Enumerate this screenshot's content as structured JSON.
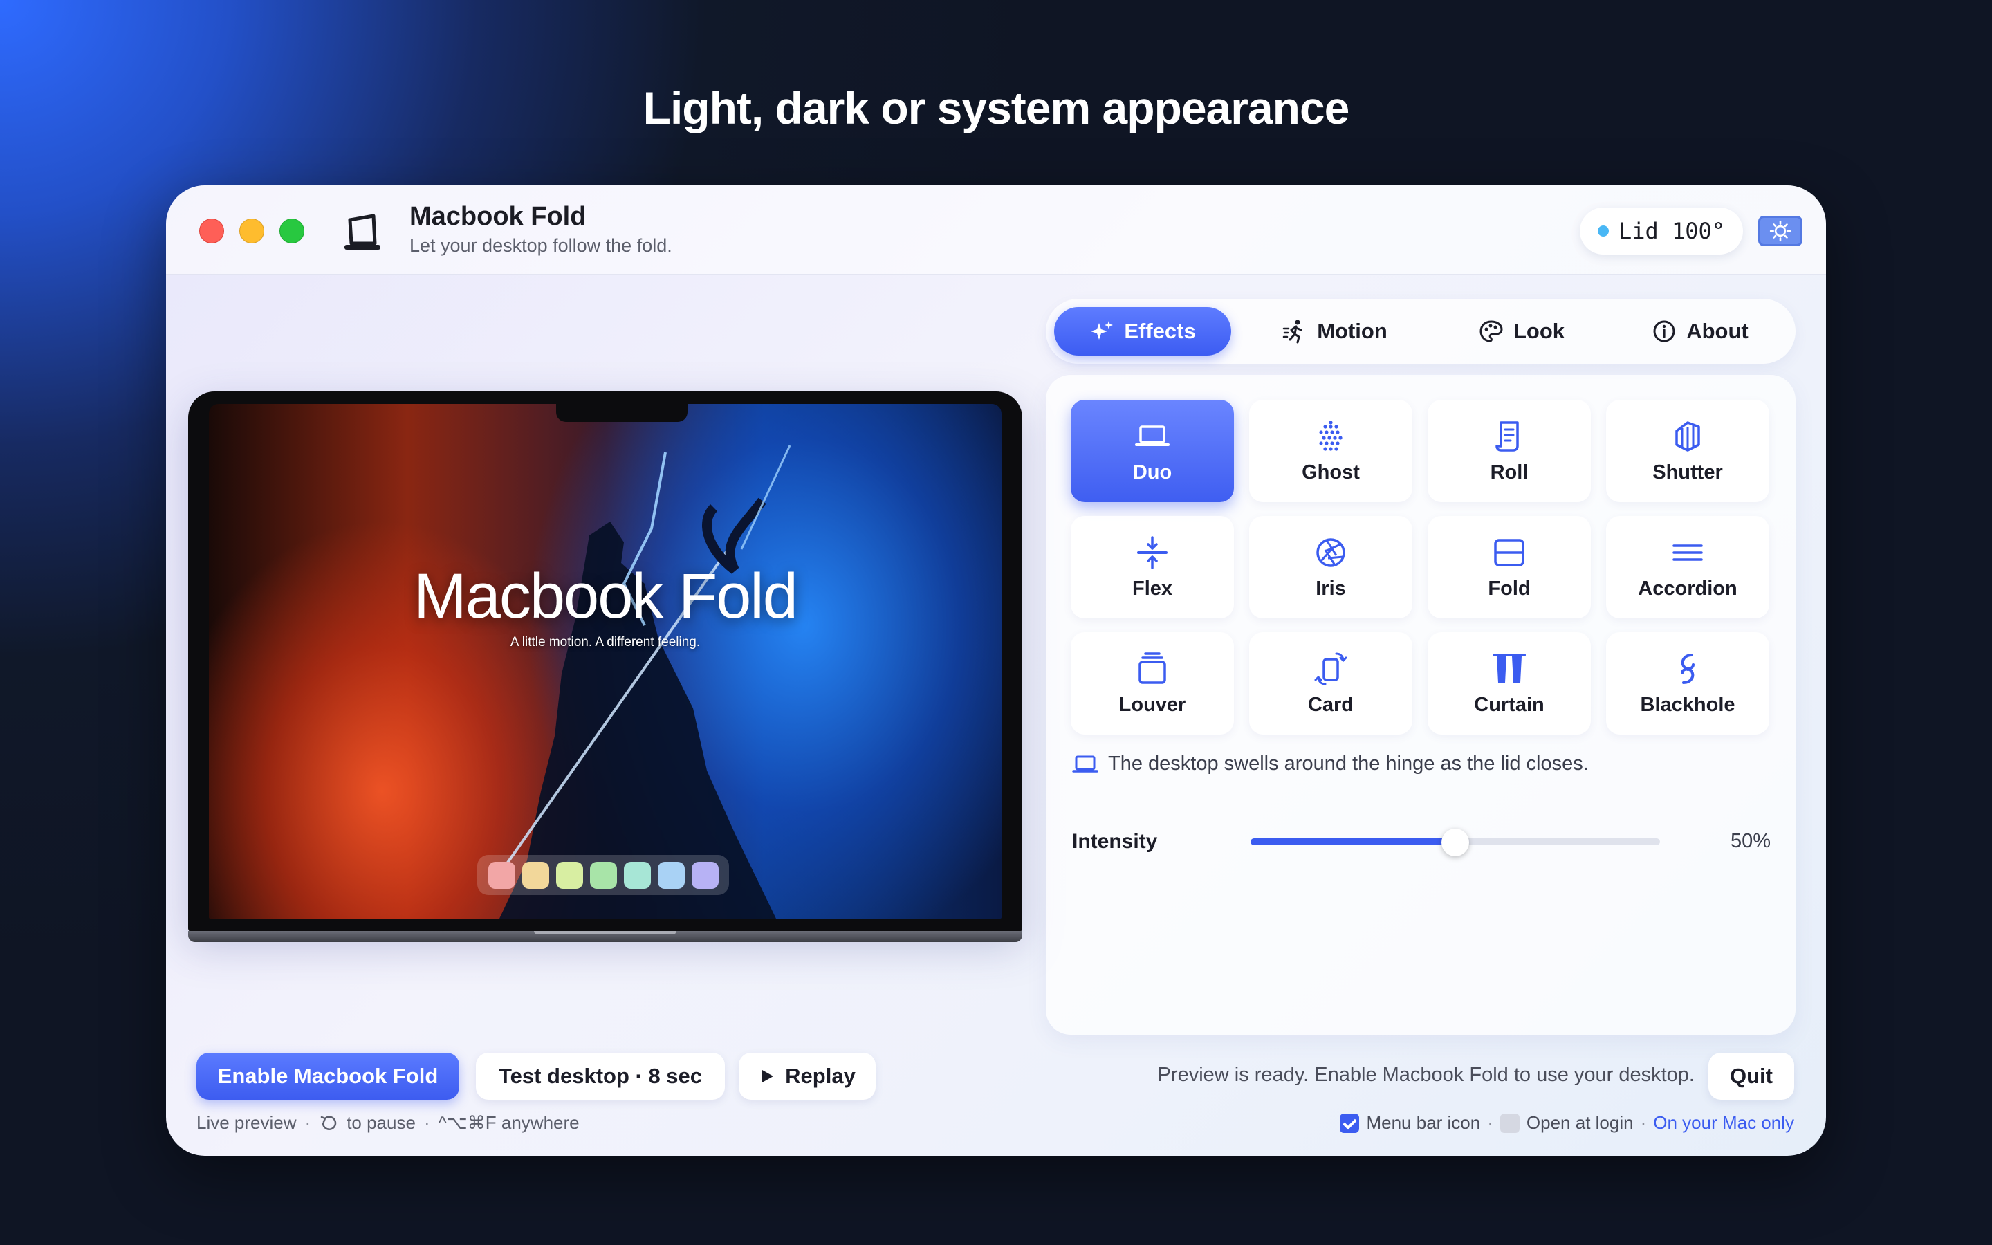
{
  "headline": "Light, dark or system appearance",
  "window": {
    "title": "Macbook Fold",
    "subtitle": "Let your desktop follow the fold.",
    "lid_status": "Lid 100°",
    "appearance_icon": "appearance-toggle-icon"
  },
  "preview": {
    "screen_title": "Macbook Fold",
    "screen_tagline": "A little motion. A different feeling.",
    "dock_colors": [
      "#f2a6a6",
      "#f2d79a",
      "#d8eea2",
      "#a8e4a8",
      "#a7e6d6",
      "#a9d2f5",
      "#b7b2f5"
    ]
  },
  "tabs": [
    {
      "label": "Effects",
      "icon": "sparkles-icon",
      "active": true
    },
    {
      "label": "Motion",
      "icon": "running-figure-icon",
      "active": false
    },
    {
      "label": "Look",
      "icon": "palette-icon",
      "active": false
    },
    {
      "label": "About",
      "icon": "info-icon",
      "active": false
    }
  ],
  "effects": [
    {
      "label": "Duo",
      "icon": "laptop-icon",
      "selected": true
    },
    {
      "label": "Ghost",
      "icon": "dots-grid-icon",
      "selected": false
    },
    {
      "label": "Roll",
      "icon": "scroll-icon",
      "selected": false
    },
    {
      "label": "Shutter",
      "icon": "shutter-panels-icon",
      "selected": false
    },
    {
      "label": "Flex",
      "icon": "compress-arrows-icon",
      "selected": false
    },
    {
      "label": "Iris",
      "icon": "aperture-icon",
      "selected": false
    },
    {
      "label": "Fold",
      "icon": "fold-rectangle-icon",
      "selected": false
    },
    {
      "label": "Accordion",
      "icon": "lines-icon",
      "selected": false
    },
    {
      "label": "Louver",
      "icon": "stacked-cards-icon",
      "selected": false
    },
    {
      "label": "Card",
      "icon": "rotating-card-icon",
      "selected": false
    },
    {
      "label": "Curtain",
      "icon": "curtain-icon",
      "selected": false
    },
    {
      "label": "Blackhole",
      "icon": "spiral-icon",
      "selected": false
    }
  ],
  "effect_description": "The desktop swells around the hinge as the lid closes.",
  "intensity": {
    "label": "Intensity",
    "value": 50,
    "value_text": "50%"
  },
  "buttons": {
    "enable": "Enable Macbook Fold",
    "test": "Test desktop · 8 sec",
    "replay": "Replay",
    "quit": "Quit"
  },
  "status_text": "Preview is ready. Enable Macbook Fold to use your desktop.",
  "footer_left": {
    "live_preview": "Live preview",
    "pause_text": "to pause",
    "shortcut": "^⌥⌘F anywhere"
  },
  "footer_right": {
    "menu_bar_icon": {
      "label": "Menu bar icon",
      "checked": true
    },
    "open_at_login": {
      "label": "Open at login",
      "checked": false
    },
    "local_only": "On your Mac only"
  },
  "colors": {
    "accent": "#3d5cf0",
    "accent_light": "#5e7cff"
  }
}
